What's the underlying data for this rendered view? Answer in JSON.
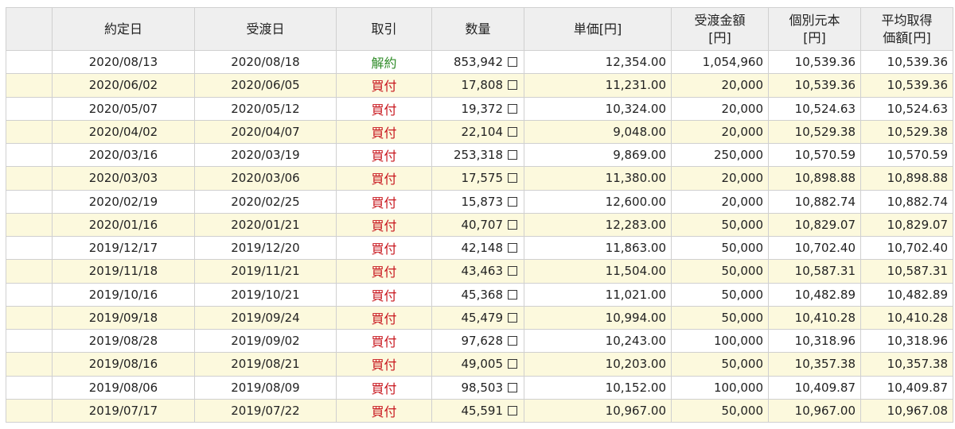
{
  "headers": {
    "contract_date": "約定日",
    "delivery_date": "受渡日",
    "trade": "取引",
    "quantity": "数量",
    "unit_price": "単価[円]",
    "delivery_amount_l1": "受渡金額",
    "delivery_amount_l2": "[円]",
    "individual_principal_l1": "個別元本",
    "individual_principal_l2": "[円]",
    "avg_cost_l1": "平均取得",
    "avg_cost_l2": "価額[円]"
  },
  "quantity_unit": "口",
  "trade_colors": {
    "買付": "#c8161d",
    "解約": "#2e8b27"
  },
  "rows": [
    {
      "contract_date": "2020/08/13",
      "delivery_date": "2020/08/18",
      "trade": "解約",
      "quantity": "853,942",
      "unit_price": "12,354.00",
      "amount": "1,054,960",
      "principal": "10,539.36",
      "avg_cost": "10,539.36"
    },
    {
      "contract_date": "2020/06/02",
      "delivery_date": "2020/06/05",
      "trade": "買付",
      "quantity": "17,808",
      "unit_price": "11,231.00",
      "amount": "20,000",
      "principal": "10,539.36",
      "avg_cost": "10,539.36"
    },
    {
      "contract_date": "2020/05/07",
      "delivery_date": "2020/05/12",
      "trade": "買付",
      "quantity": "19,372",
      "unit_price": "10,324.00",
      "amount": "20,000",
      "principal": "10,524.63",
      "avg_cost": "10,524.63"
    },
    {
      "contract_date": "2020/04/02",
      "delivery_date": "2020/04/07",
      "trade": "買付",
      "quantity": "22,104",
      "unit_price": "9,048.00",
      "amount": "20,000",
      "principal": "10,529.38",
      "avg_cost": "10,529.38"
    },
    {
      "contract_date": "2020/03/16",
      "delivery_date": "2020/03/19",
      "trade": "買付",
      "quantity": "253,318",
      "unit_price": "9,869.00",
      "amount": "250,000",
      "principal": "10,570.59",
      "avg_cost": "10,570.59"
    },
    {
      "contract_date": "2020/03/03",
      "delivery_date": "2020/03/06",
      "trade": "買付",
      "quantity": "17,575",
      "unit_price": "11,380.00",
      "amount": "20,000",
      "principal": "10,898.88",
      "avg_cost": "10,898.88"
    },
    {
      "contract_date": "2020/02/19",
      "delivery_date": "2020/02/25",
      "trade": "買付",
      "quantity": "15,873",
      "unit_price": "12,600.00",
      "amount": "20,000",
      "principal": "10,882.74",
      "avg_cost": "10,882.74"
    },
    {
      "contract_date": "2020/01/16",
      "delivery_date": "2020/01/21",
      "trade": "買付",
      "quantity": "40,707",
      "unit_price": "12,283.00",
      "amount": "50,000",
      "principal": "10,829.07",
      "avg_cost": "10,829.07"
    },
    {
      "contract_date": "2019/12/17",
      "delivery_date": "2019/12/20",
      "trade": "買付",
      "quantity": "42,148",
      "unit_price": "11,863.00",
      "amount": "50,000",
      "principal": "10,702.40",
      "avg_cost": "10,702.40"
    },
    {
      "contract_date": "2019/11/18",
      "delivery_date": "2019/11/21",
      "trade": "買付",
      "quantity": "43,463",
      "unit_price": "11,504.00",
      "amount": "50,000",
      "principal": "10,587.31",
      "avg_cost": "10,587.31"
    },
    {
      "contract_date": "2019/10/16",
      "delivery_date": "2019/10/21",
      "trade": "買付",
      "quantity": "45,368",
      "unit_price": "11,021.00",
      "amount": "50,000",
      "principal": "10,482.89",
      "avg_cost": "10,482.89"
    },
    {
      "contract_date": "2019/09/18",
      "delivery_date": "2019/09/24",
      "trade": "買付",
      "quantity": "45,479",
      "unit_price": "10,994.00",
      "amount": "50,000",
      "principal": "10,410.28",
      "avg_cost": "10,410.28"
    },
    {
      "contract_date": "2019/08/28",
      "delivery_date": "2019/09/02",
      "trade": "買付",
      "quantity": "97,628",
      "unit_price": "10,243.00",
      "amount": "100,000",
      "principal": "10,318.96",
      "avg_cost": "10,318.96"
    },
    {
      "contract_date": "2019/08/16",
      "delivery_date": "2019/08/21",
      "trade": "買付",
      "quantity": "49,005",
      "unit_price": "10,203.00",
      "amount": "50,000",
      "principal": "10,357.38",
      "avg_cost": "10,357.38"
    },
    {
      "contract_date": "2019/08/06",
      "delivery_date": "2019/08/09",
      "trade": "買付",
      "quantity": "98,503",
      "unit_price": "10,152.00",
      "amount": "100,000",
      "principal": "10,409.87",
      "avg_cost": "10,409.87"
    },
    {
      "contract_date": "2019/07/17",
      "delivery_date": "2019/07/22",
      "trade": "買付",
      "quantity": "45,591",
      "unit_price": "10,967.00",
      "amount": "50,000",
      "principal": "10,967.00",
      "avg_cost": "10,967.08"
    }
  ]
}
